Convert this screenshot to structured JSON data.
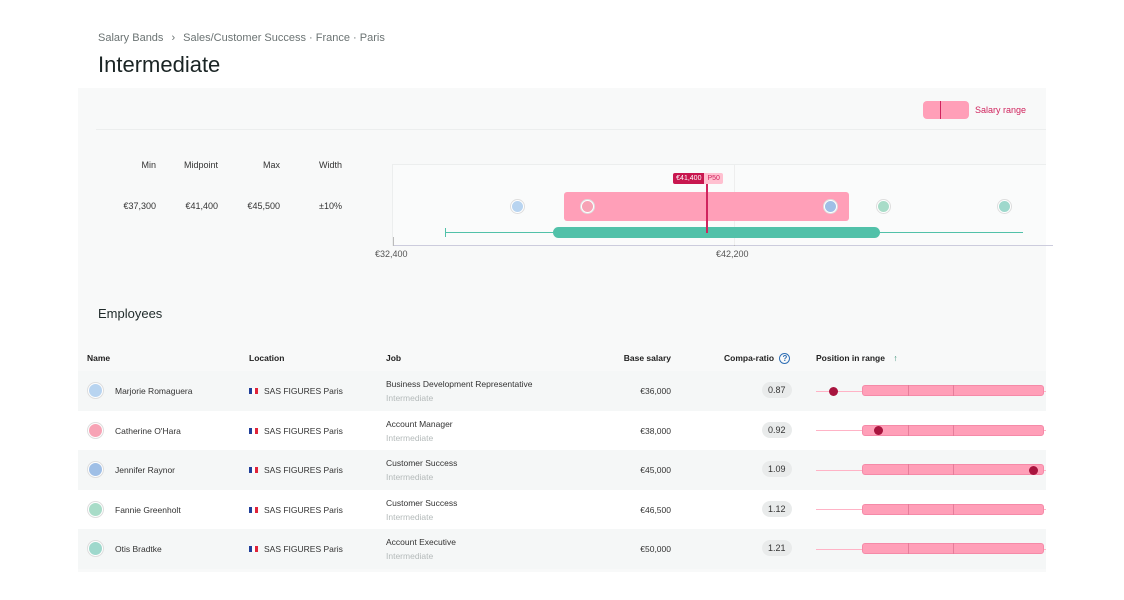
{
  "breadcrumb": {
    "root": "Salary Bands",
    "separator": "›",
    "path": "Sales/Customer Success · France · Paris"
  },
  "title": "Intermediate",
  "legend": {
    "salary_range": "Salary range"
  },
  "stats": {
    "headers": [
      "Min",
      "Midpoint",
      "Max",
      "Width"
    ],
    "values": [
      "€37,300",
      "€41,400",
      "€45,500",
      "±10%"
    ]
  },
  "chart": {
    "axis_min": 32400,
    "axis_labels": [
      "€32,400",
      "€42,200"
    ],
    "axis_ticks": [
      32400,
      42200
    ],
    "range": [
      37300,
      45500
    ],
    "midpoint": 41400,
    "midpoint_label": "€41,400",
    "percentile_label": "P50",
    "market_whisker": [
      33900,
      50500
    ],
    "market_box": [
      37000,
      46400
    ],
    "employee_salaries": [
      36000,
      38000,
      45000,
      46500,
      50000
    ]
  },
  "colors": {
    "range": "#ff9fb8",
    "accent": "#d0245e",
    "teal": "#51c1a9",
    "dot": "#a8143e"
  },
  "employees_title": "Employees",
  "columns": {
    "name": "Name",
    "location": "Location",
    "job": "Job",
    "base": "Base salary",
    "compa": "Compa-ratio",
    "position": "Position in range",
    "sort_icon": "arrow-up"
  },
  "rows": [
    {
      "name": "Marjorie Romaguera",
      "location": "SAS FIGURES Paris",
      "job": "Business Development Representative",
      "level": "Intermediate",
      "base": "€36,000",
      "compa": "0.87",
      "salary": 36000,
      "avatar": "#b8d4f0"
    },
    {
      "name": "Catherine O'Hara",
      "location": "SAS FIGURES Paris",
      "job": "Account Manager",
      "level": "Intermediate",
      "base": "€38,000",
      "compa": "0.92",
      "salary": 38000,
      "avatar": "#f7a3b5"
    },
    {
      "name": "Jennifer Raynor",
      "location": "SAS FIGURES Paris",
      "job": "Customer Success",
      "level": "Intermediate",
      "base": "€45,000",
      "compa": "1.09",
      "salary": 45000,
      "avatar": "#9fbfe6"
    },
    {
      "name": "Fannie Greenholt",
      "location": "SAS FIGURES Paris",
      "job": "Customer Success",
      "level": "Intermediate",
      "base": "€46,500",
      "compa": "1.12",
      "salary": 46500,
      "avatar": "#a8dcc8"
    },
    {
      "name": "Otis Bradtke",
      "location": "SAS FIGURES Paris",
      "job": "Account Executive",
      "level": "Intermediate",
      "base": "€50,000",
      "compa": "1.21",
      "salary": 50000,
      "avatar": "#9ed8cc"
    }
  ]
}
